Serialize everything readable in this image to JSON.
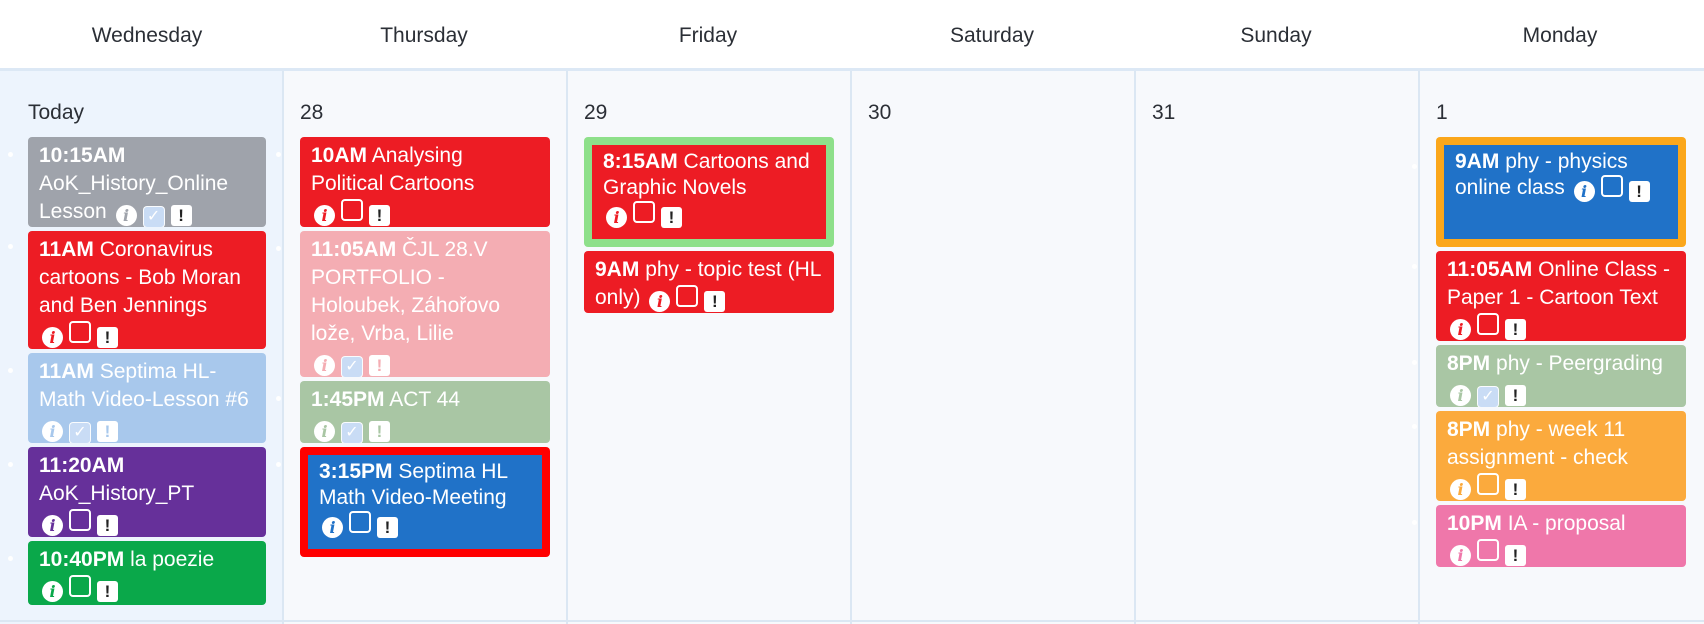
{
  "header": {
    "days": [
      "Wednesday",
      "Thursday",
      "Friday",
      "Saturday",
      "Sunday",
      "Monday"
    ]
  },
  "dates": [
    "Today",
    "28",
    "29",
    "30",
    "31",
    "1"
  ],
  "events": {
    "wed": [
      {
        "time": "10:15AM",
        "title": "AoK_History_Online Lesson",
        "color": "#9fa3ab"
      },
      {
        "time": "11AM",
        "title": "Coronavirus cartoons - Bob Moran and Ben Jennings",
        "color": "#ed1c24"
      },
      {
        "time": "11AM",
        "title": "Septima HL-Math Video-Lesson #6",
        "color": "#a8c8ec"
      },
      {
        "time": "11:20AM",
        "title": "AoK_History_PT",
        "color": "#66309a"
      },
      {
        "time": "10:40PM",
        "title": "la poezie",
        "color": "#0aa84a"
      }
    ],
    "thu": [
      {
        "time": "10AM",
        "title": "Analysing Political Cartoons",
        "color": "#ed1c24"
      },
      {
        "time": "11:05AM",
        "title": "ČJL 28.V PORTFOLIO - Holoubek, Záhořovo lože, Vrba, Lilie",
        "color": "#f4adb3"
      },
      {
        "time": "1:45PM",
        "title": "ACT 44",
        "color": "#a9c6a4"
      },
      {
        "time": "3:15PM",
        "title": "Septima HL Math Video-Meeting",
        "color": "#2072c8",
        "frame": "#ff0000"
      }
    ],
    "fri": [
      {
        "time": "8:15AM",
        "title": "Cartoons and Graphic Novels",
        "color": "#ed1c24",
        "frame": "#8ee08a"
      },
      {
        "time": "9AM",
        "title": "phy - topic test (HL only)",
        "color": "#ed1c24"
      }
    ],
    "mon": [
      {
        "time": "9AM",
        "title": "phy - physics online class",
        "color": "#2072c8",
        "frame": "#fba71b"
      },
      {
        "time": "11:05AM",
        "title": "Online Class - Paper 1 - Cartoon Text",
        "color": "#ed1c24"
      },
      {
        "time": "8PM",
        "title": "phy - Peergrading",
        "color": "#a9c6a4"
      },
      {
        "time": "8PM",
        "title": "phy - week 11 assignment - check",
        "color": "#fbaa3d"
      },
      {
        "time": "10PM",
        "title": "IA - proposal",
        "color": "#ef77aa"
      }
    ]
  }
}
